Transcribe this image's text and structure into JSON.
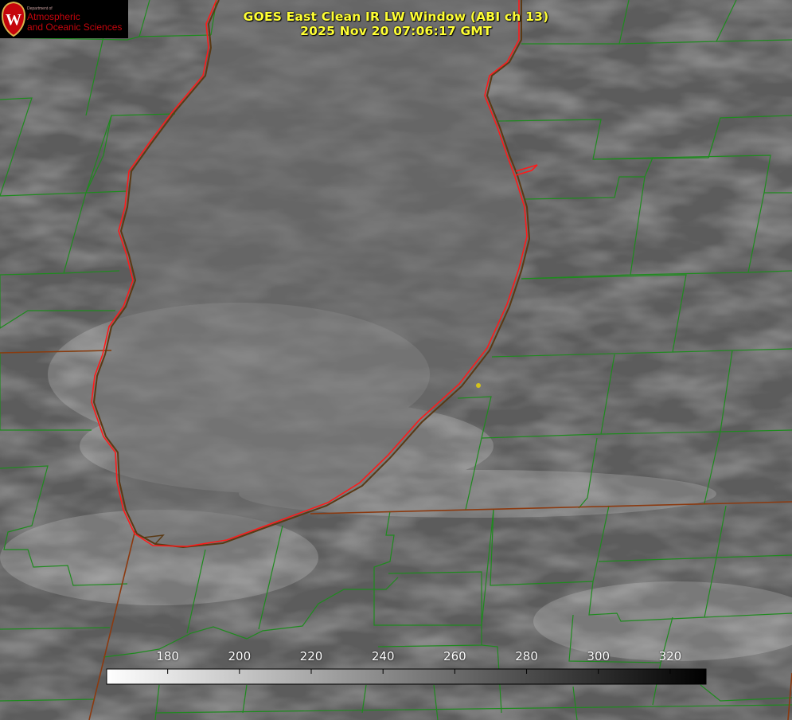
{
  "logo": {
    "department": "Department of",
    "line1": "Atmospheric",
    "line2": "and Oceanic Sciences",
    "crest_letter": "W",
    "brand_color": "#c5050c"
  },
  "title": {
    "line1": "GOES East Clean IR LW Window (ABI ch 13)",
    "line2": "2025 Nov 20 07:06:17 GMT"
  },
  "colorbar": {
    "min": 163,
    "max": 330,
    "ticks": [
      "180",
      "200",
      "220",
      "240",
      "260",
      "280",
      "300",
      "320"
    ],
    "tick_values": [
      180,
      200,
      220,
      240,
      260,
      280,
      300,
      320
    ],
    "color_low": "#ffffff",
    "color_high": "#000000"
  },
  "colors": {
    "county_lines": "#1f8a1f",
    "state_lines": "#8b3a10",
    "lake_coast": "#ff1a1a",
    "marker": "#d4c21a",
    "title_text": "#ffff33"
  },
  "icons": {
    "logo": "uw-crest-icon",
    "station": "station-marker-icon"
  }
}
